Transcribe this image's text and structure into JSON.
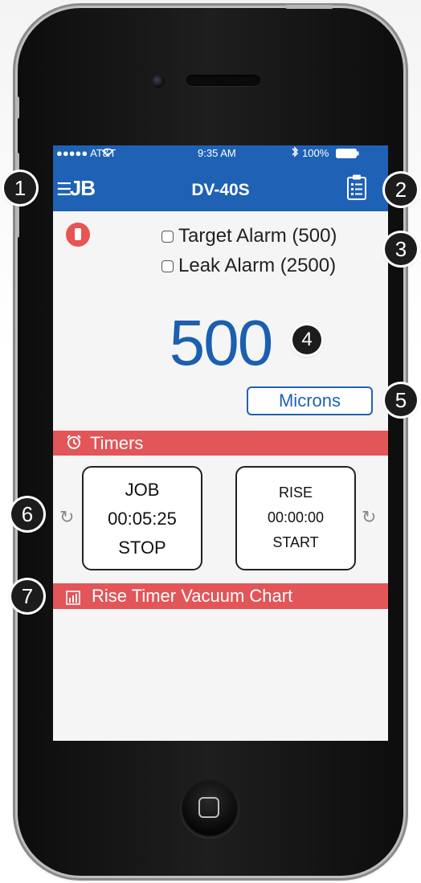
{
  "status_bar": {
    "carrier": "●●●●● AT&T",
    "time": "9:35 AM",
    "battery": "100%"
  },
  "nav": {
    "logo": "JB",
    "title": "DV-40S"
  },
  "alarms": [
    {
      "label": "Target Alarm (500)",
      "checked": false
    },
    {
      "label": "Leak Alarm (2500)",
      "checked": false
    }
  ],
  "reading": {
    "value": "500",
    "unit_button": "Microns"
  },
  "timers": {
    "header": "Timers",
    "job": {
      "line1": "JOB",
      "line2": "00:05:25",
      "line3": "STOP"
    },
    "rise": {
      "line1": "RISE",
      "line2": "00:00:00",
      "line3": "START"
    }
  },
  "chart": {
    "header": "Rise Timer Vacuum Chart"
  },
  "callouts": [
    "1",
    "2",
    "3",
    "4",
    "5",
    "6",
    "7"
  ],
  "colors": {
    "brand_blue": "#1f62b5",
    "section_red": "#e25558",
    "reading_blue": "#1c5fb0"
  }
}
